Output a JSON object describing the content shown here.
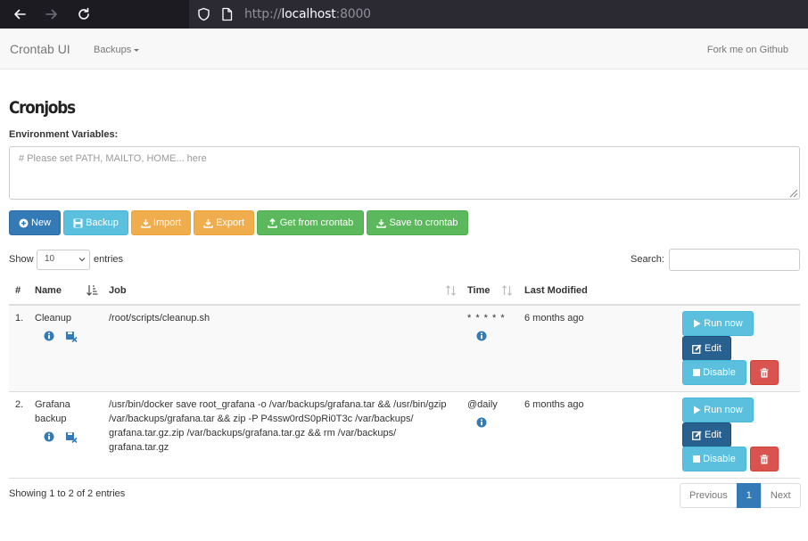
{
  "browser": {
    "url_scheme": "http://",
    "url_host": "localhost",
    "url_port": ":8000"
  },
  "navbar": {
    "brand": "Crontab UI",
    "backups_menu": "Backups",
    "fork_link": "Fork me on Github"
  },
  "page": {
    "title": "Cronjobs",
    "env_label": "Environment Variables:",
    "env_placeholder": "# Please set PATH, MAILTO, HOME... here"
  },
  "toolbar": {
    "new_label": "New",
    "backup_label": "Backup",
    "import_label": "Import",
    "export_label": "Export",
    "get_label": "Get from crontab",
    "save_label": "Save to crontab"
  },
  "table_controls": {
    "show_label": "Show",
    "entries_value": "10",
    "entries_label": "entries",
    "search_label": "Search:"
  },
  "table": {
    "headers": [
      "#",
      "Name",
      "Job",
      "Time",
      "Last Modified"
    ],
    "rows": [
      {
        "num": "1.",
        "name": "Cleanup",
        "job": "/root/scripts/cleanup.sh",
        "time": "* * * * *",
        "modified": "6 months ago"
      },
      {
        "num": "2.",
        "name": "Grafana backup",
        "job": "/usr/bin/docker save root_grafana -o /var/backups/grafana.tar && /usr/bin/gzip /var/backups/grafana.tar && zip -P P4ssw0rdS0pRi0T3c /var/backups/ grafana.tar.gz.zip /var/backups/grafana.tar.gz && rm /var/backups/ grafana.tar.gz",
        "time": "@daily",
        "modified": "6 months ago"
      }
    ],
    "actions": {
      "run_label": "Run now",
      "edit_label": "Edit",
      "disable_label": "Disable"
    }
  },
  "footer": {
    "info": "Showing 1 to 2 of 2 entries",
    "prev": "Previous",
    "page": "1",
    "next": "Next"
  },
  "colors": {
    "primary": "#337ab7",
    "info": "#5bc0de",
    "warning": "#f0ad4e",
    "success": "#5cb85c",
    "danger": "#d9534f"
  }
}
